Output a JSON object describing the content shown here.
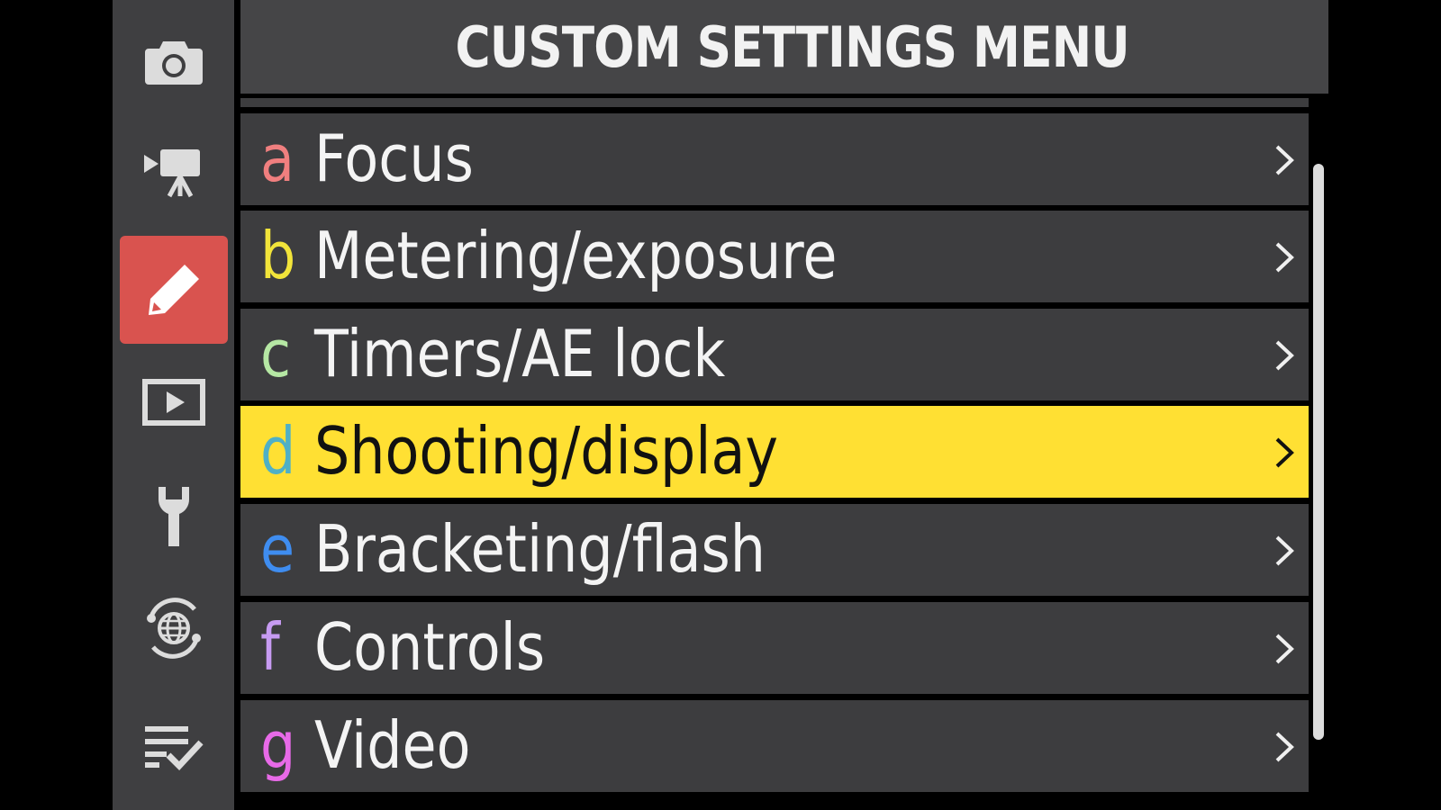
{
  "header": {
    "title": "CUSTOM SETTINGS MENU"
  },
  "sidebar": {
    "tabs": [
      {
        "name": "photo-shooting-menu-tab",
        "icon": "camera-icon",
        "active": false
      },
      {
        "name": "video-recording-menu-tab",
        "icon": "movie-camera-icon",
        "active": false
      },
      {
        "name": "custom-settings-menu-tab",
        "icon": "pencil-icon",
        "active": true
      },
      {
        "name": "playback-menu-tab",
        "icon": "playback-icon",
        "active": false
      },
      {
        "name": "setup-menu-tab",
        "icon": "wrench-icon",
        "active": false
      },
      {
        "name": "network-menu-tab",
        "icon": "globe-network-icon",
        "active": false
      },
      {
        "name": "my-menu-tab",
        "icon": "checklist-icon",
        "active": false
      }
    ]
  },
  "menu": {
    "items": [
      {
        "letter": "a",
        "label": "Focus",
        "letter_color": "#f07f7f",
        "selected": false
      },
      {
        "letter": "b",
        "label": "Metering/exposure",
        "letter_color": "#f2e43a",
        "selected": false
      },
      {
        "letter": "c",
        "label": "Timers/AE lock",
        "letter_color": "#b6e8a4",
        "selected": false
      },
      {
        "letter": "d",
        "label": "Shooting/display",
        "letter_color": "#4fb0c6",
        "selected": true
      },
      {
        "letter": "e",
        "label": "Bracketing/flash",
        "letter_color": "#3f8df0",
        "selected": false
      },
      {
        "letter": "f",
        "label": "Controls",
        "letter_color": "#c79bf2",
        "selected": false
      },
      {
        "letter": "g",
        "label": "Video",
        "letter_color": "#e86ae8",
        "selected": false
      }
    ]
  },
  "colors": {
    "accent_active_tab": "#d9534f",
    "selection_highlight": "#ffe033",
    "row_background": "#3d3d3f",
    "sidebar_background": "#3f3f41"
  }
}
